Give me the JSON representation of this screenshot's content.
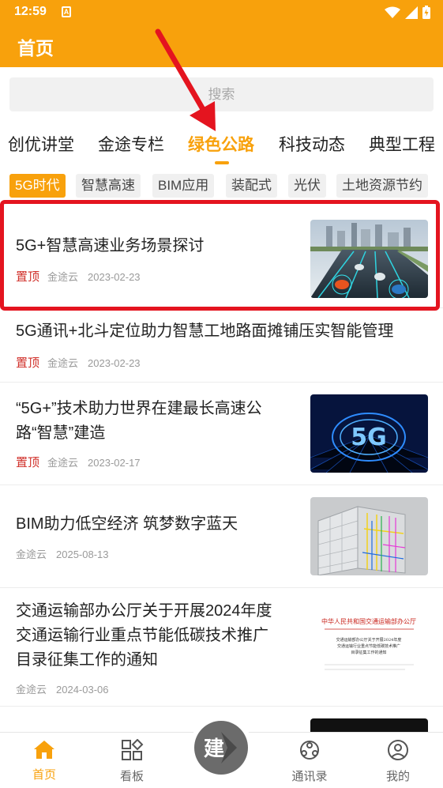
{
  "status": {
    "time": "12:59",
    "notification": "A"
  },
  "header": {
    "title": "首页"
  },
  "search": {
    "placeholder": "搜索"
  },
  "tabs": [
    {
      "label": "创优讲堂",
      "active": false
    },
    {
      "label": "金途专栏",
      "active": false
    },
    {
      "label": "绿色公路",
      "active": true
    },
    {
      "label": "科技动态",
      "active": false
    },
    {
      "label": "典型工程",
      "active": false
    }
  ],
  "chips": [
    {
      "label": "5G时代",
      "active": true
    },
    {
      "label": "智慧高速",
      "active": false
    },
    {
      "label": "BIM应用",
      "active": false
    },
    {
      "label": "装配式",
      "active": false
    },
    {
      "label": "光伏",
      "active": false
    },
    {
      "label": "土地资源节约",
      "active": false
    }
  ],
  "articles": [
    {
      "title": "5G+智慧高速业务场景探讨",
      "pin": "置顶",
      "source": "金途云",
      "date": "2023-02-23",
      "thumb": "highway-scene"
    },
    {
      "title": "5G通讯+北斗定位助力智慧工地路面摊铺压实智能管理",
      "pin": "置顶",
      "source": "金途云",
      "date": "2023-02-23",
      "thumb": ""
    },
    {
      "title_line1": "“5G+”技术助力世界在建最长高速公",
      "title_line2": "路“智慧”建造",
      "pin": "置顶",
      "source": "金途云",
      "date": "2023-02-17",
      "thumb": "5g-logo",
      "thumb_text": "5G"
    },
    {
      "title": "BIM助力低空经济 筑梦数字蓝天",
      "pin": "",
      "source": "金途云",
      "date": "2025-08-13",
      "thumb": "bim-building"
    },
    {
      "title_line1": "交通运输部办公厅关于开展2024年度",
      "title_line2": "交通运输行业重点节能低碳技术推广",
      "title_line3": "目录征集工作的通知",
      "pin": "",
      "source": "金途云",
      "date": "2024-03-06",
      "thumb": "document",
      "doc": {
        "heading": "中华人民共和国交通运输部办公厅",
        "line1": "交通运输部办公厅关于开展2024年度",
        "line2": "交通运输行业重点节能低碳技术推广",
        "line3": "目录征集工作的通知"
      }
    }
  ],
  "bottom_nav": [
    {
      "label": "首页",
      "icon": "home-icon",
      "active": true
    },
    {
      "label": "看板",
      "icon": "dashboard-icon",
      "active": false
    },
    {
      "label": "建",
      "icon": "build-icon",
      "active": false
    },
    {
      "label": "通讯录",
      "icon": "contacts-icon",
      "active": false
    },
    {
      "label": "我的",
      "icon": "profile-icon",
      "active": false
    }
  ],
  "colors": {
    "accent": "#f8a10c",
    "pin": "#d0302a",
    "highlight": "#e4141f"
  }
}
